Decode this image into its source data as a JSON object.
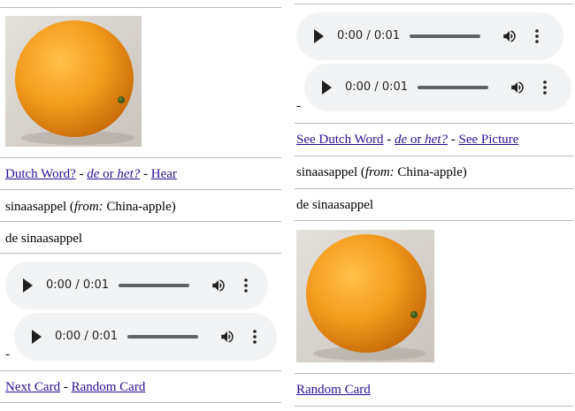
{
  "left": {
    "nav": {
      "dutch_word": "Dutch Word?",
      "sep1": "-",
      "de_or": "de",
      "or_text": "or",
      "het": "het?",
      "sep2": "-",
      "hear": "Hear"
    },
    "word_line": {
      "word": "sinaasappel",
      "from_label": "from:",
      "origin": "China-apple"
    },
    "article_line": "de sinaasappel",
    "audio": [
      {
        "time": "0:00 / 0:01"
      },
      {
        "time": "0:00 / 0:01"
      }
    ],
    "dash": "-",
    "footer": {
      "next_card": "Next Card",
      "sep": "-",
      "random_card": "Random Card"
    }
  },
  "right": {
    "audio": [
      {
        "time": "0:00 / 0:01"
      },
      {
        "time": "0:00 / 0:01"
      }
    ],
    "dash": "-",
    "nav": {
      "see_dutch_word": "See Dutch Word",
      "sep1": "-",
      "de_or": "de",
      "or_text": "or",
      "het": "het?",
      "sep2": "-",
      "see_picture": "See Picture"
    },
    "word_line": {
      "word": "sinaasappel",
      "from_label": "from:",
      "origin": "China-apple"
    },
    "article_line": "de sinaasappel",
    "footer": {
      "random_card": "Random Card"
    }
  },
  "image": {
    "subject": "orange-fruit-photo",
    "colors": {
      "fruit": "#f39a1c",
      "background": "#d9d4ce"
    }
  },
  "colors": {
    "link": "#2c0e94",
    "player_bg": "#f1f3f4",
    "divider": "#b9b9b9"
  }
}
